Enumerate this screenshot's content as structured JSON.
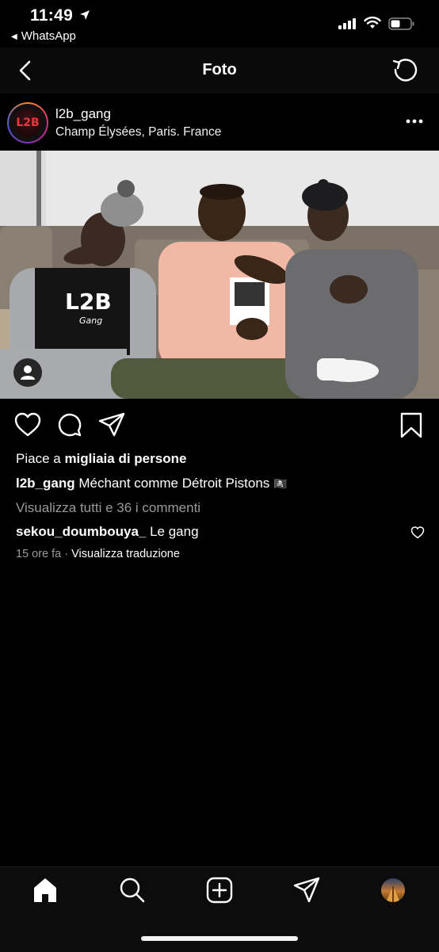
{
  "status_bar": {
    "time": "11:49",
    "back_app": "WhatsApp",
    "icons": [
      "location-arrow-icon",
      "signal-icon",
      "wifi-icon",
      "battery-icon"
    ]
  },
  "nav": {
    "title": "Foto",
    "icons": [
      "chevron-left-icon",
      "refresh-icon"
    ]
  },
  "post": {
    "username": "l2b_gang",
    "location": "Champ Élysées, Paris. France",
    "avatar_text": "L2B",
    "photo_shirt_text": "L2B",
    "photo_shirt_subtext": "Gang",
    "likes_prefix": "Piace a ",
    "likes_bold": "migliaia di persone",
    "caption_user": "l2b_gang",
    "caption_text": " Méchant comme Détroit Pistons ",
    "caption_emoji": "🏴‍☠️",
    "view_all_comments": "Visualizza tutti e 36 i commenti",
    "comment_user": "sekou_doumbouya_",
    "comment_text": " Le gang",
    "time_ago": "15 ore fa",
    "separator": " · ",
    "translate": "Visualizza traduzione"
  },
  "tab_bar": {
    "items": [
      "home-icon",
      "search-icon",
      "new-post-icon",
      "direct-icon",
      "profile-avatar"
    ]
  },
  "colors": {
    "background": "#000000",
    "secondary_text": "#9a9a9a",
    "ring": [
      "#f58529",
      "#dd2a7b",
      "#8134af",
      "#515bd4"
    ]
  }
}
